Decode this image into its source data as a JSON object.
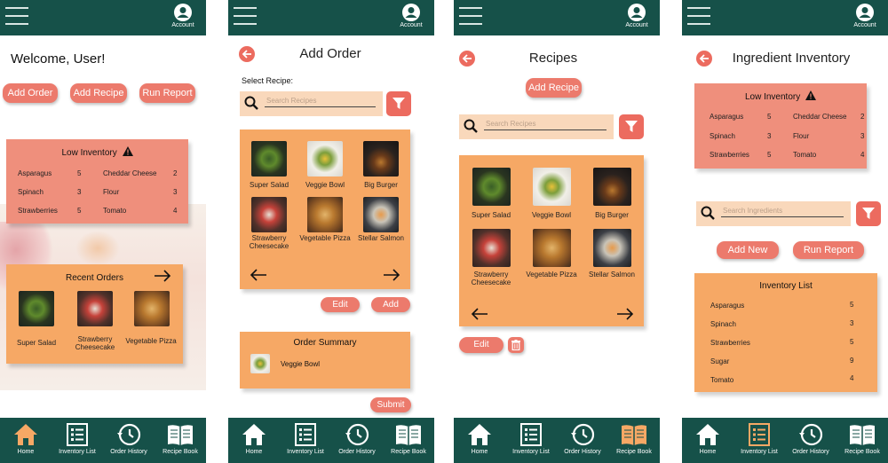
{
  "common": {
    "account_label": "Account",
    "nav": [
      "Home",
      "Inventory List",
      "Order History",
      "Recipe Book"
    ]
  },
  "colors": {
    "topbar": "#165149",
    "accent": "#ec7a6c",
    "panel_orange": "#f6a865",
    "panel_salmon": "#ef8f7c",
    "active_nav": "#f6a865"
  },
  "home": {
    "welcome": "Welcome, User!",
    "buttons": [
      "Add Order",
      "Add Recipe",
      "Run Report"
    ],
    "low_inventory": {
      "title": "Low Inventory",
      "items": [
        {
          "name": "Asparagus",
          "qty": "5"
        },
        {
          "name": "Cheddar Cheese",
          "qty": "2"
        },
        {
          "name": "Spinach",
          "qty": "3"
        },
        {
          "name": "Flour",
          "qty": "3"
        },
        {
          "name": "Strawberries",
          "qty": "5"
        },
        {
          "name": "Tomato",
          "qty": "4"
        }
      ]
    },
    "recent_orders": {
      "title": "Recent Orders",
      "items": [
        "Super Salad",
        "Strawberry Cheesecake",
        "Vegetable Pizza"
      ]
    },
    "active_nav": "Home"
  },
  "add_order": {
    "title": "Add Order",
    "select_label": "Select Recipe:",
    "search_placeholder": "Search Recipes",
    "recipes": [
      "Super Salad",
      "Veggie Bowl",
      "Big Burger",
      "Strawberry Cheesecake",
      "Vegetable Pizza",
      "Stellar Salmon"
    ],
    "edit_label": "Edit",
    "add_label": "Add",
    "summary_title": "Order Summary",
    "summary_item": "Veggie Bowl",
    "submit_label": "Submit"
  },
  "recipes": {
    "title": "Recipes",
    "add_label": "Add Recipe",
    "search_placeholder": "Search Recipes",
    "recipes": [
      "Super Salad",
      "Veggie Bowl",
      "Big Burger",
      "Strawberry Cheesecake",
      "Vegetable Pizza",
      "Stellar Salmon"
    ],
    "edit_label": "Edit",
    "active_nav": "Recipe Book"
  },
  "ingredients": {
    "title": "Ingredient Inventory",
    "low_inventory": {
      "title": "Low Inventory",
      "items": [
        {
          "name": "Asparagus",
          "qty": "5"
        },
        {
          "name": "Cheddar Cheese",
          "qty": "2"
        },
        {
          "name": "Spinach",
          "qty": "3"
        },
        {
          "name": "Flour",
          "qty": "3"
        },
        {
          "name": "Strawberries",
          "qty": "5"
        },
        {
          "name": "Tomato",
          "qty": "4"
        }
      ]
    },
    "search_placeholder": "Search Ingredients",
    "add_new_label": "Add New",
    "run_report_label": "Run Report",
    "inventory_list": {
      "title": "Inventory List",
      "items": [
        {
          "name": "Asparagus",
          "qty": "5"
        },
        {
          "name": "Spinach",
          "qty": "3"
        },
        {
          "name": "Strawberries",
          "qty": "5"
        },
        {
          "name": "Sugar",
          "qty": "9"
        },
        {
          "name": "Tomato",
          "qty": "4"
        }
      ]
    },
    "active_nav": "Inventory List"
  }
}
